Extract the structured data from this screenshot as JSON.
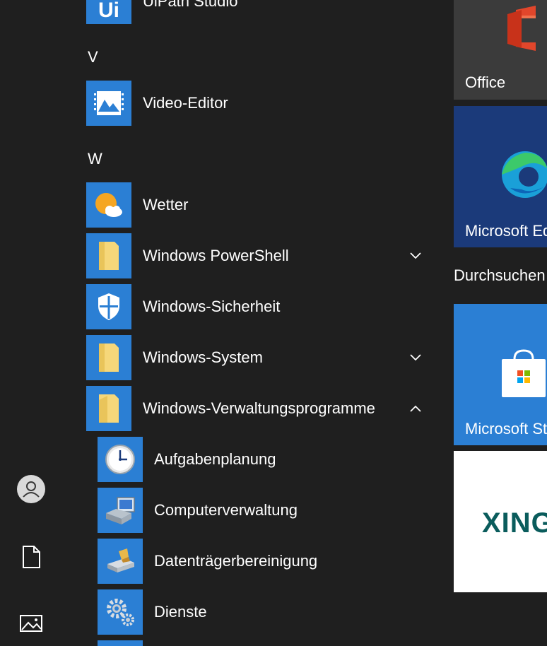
{
  "rail": {
    "items": [
      {
        "icon": "user-icon"
      },
      {
        "icon": "document-icon"
      },
      {
        "icon": "pictures-icon"
      }
    ]
  },
  "app_list": {
    "partial_top": {
      "label": "UiPath Studio",
      "icon": "uipath-icon"
    },
    "groups": [
      {
        "letter": "V"
      },
      {
        "letter": "W"
      }
    ],
    "apps": [
      {
        "label": "Video-Editor",
        "icon": "video-editor-icon"
      },
      {
        "label": "Wetter",
        "icon": "weather-icon"
      },
      {
        "label": "Windows PowerShell",
        "icon": "folder-icon",
        "expander": "collapsed"
      },
      {
        "label": "Windows-Sicherheit",
        "icon": "shield-icon"
      },
      {
        "label": "Windows-System",
        "icon": "folder-icon",
        "expander": "collapsed"
      },
      {
        "label": "Windows-Verwaltungsprogramme",
        "icon": "folder-icon",
        "expander": "expanded"
      }
    ],
    "sub_apps": [
      {
        "label": "Aufgabenplanung",
        "icon": "clock-icon"
      },
      {
        "label": "Computerverwaltung",
        "icon": "computer-management-icon"
      },
      {
        "label": "Datenträgerbereinigung",
        "icon": "disk-cleanup-icon"
      },
      {
        "label": "Dienste",
        "icon": "gears-icon"
      }
    ]
  },
  "tiles": {
    "office": {
      "label": "Office",
      "icon": "office-icon"
    },
    "edge": {
      "label": "Microsoft Edge",
      "icon": "edge-icon"
    },
    "section_title": "Durchsuchen",
    "store": {
      "label": "Microsoft Store",
      "icon": "store-icon"
    },
    "xing": {
      "text": "XING",
      "icon": "xing-logo"
    }
  },
  "colors": {
    "background": "#1f1f1f",
    "tile_blue": "#2b7fd4",
    "edge_tile": "#1b3a7a",
    "office_tile": "#3b3b3b"
  }
}
